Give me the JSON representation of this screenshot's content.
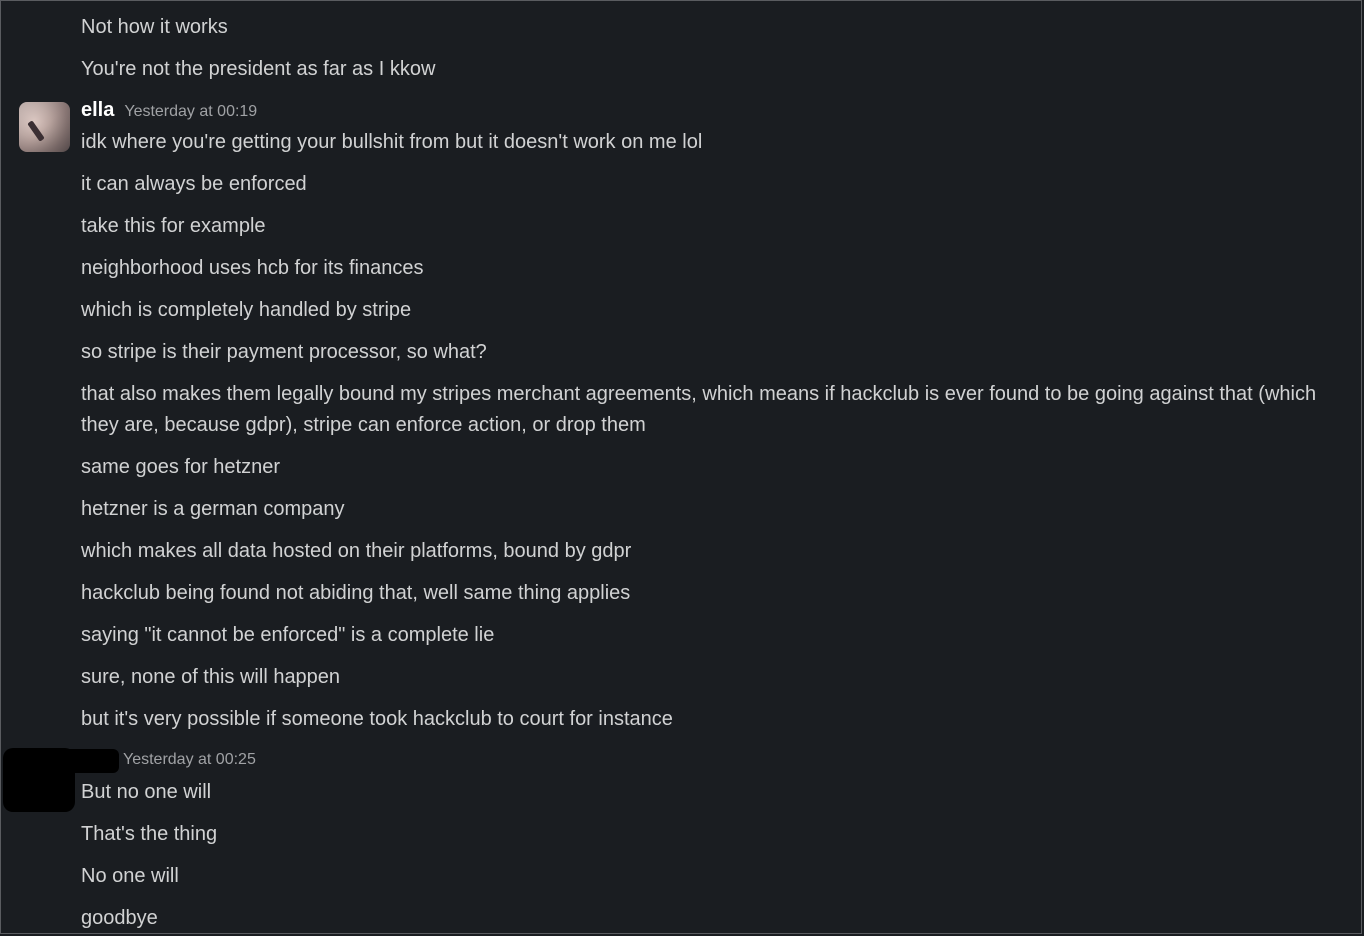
{
  "messages_top": [
    "Not how it works",
    "You're not the president as far as I kkow"
  ],
  "ella": {
    "name": "ella",
    "timestamp": "Yesterday at 00:19",
    "messages": [
      "idk where you're getting your bullshit from but it doesn't work on me lol",
      "it can always be enforced",
      "take this for example",
      "neighborhood uses hcb for its finances",
      "which is completely handled by stripe",
      "so stripe is their payment processor, so what?",
      "that also makes them legally bound my stripes merchant agreements, which means if hackclub is ever found to be going against that (which they are, because gdpr), stripe can enforce action, or drop them",
      "same goes for hetzner",
      "hetzner is a german company",
      "which makes all data hosted on their platforms, bound by gdpr",
      "hackclub being found not abiding that, well same thing applies",
      "saying \"it cannot be enforced\" is a complete lie",
      "sure, none of this will happen",
      "but it's very possible if someone took hackclub to court for instance"
    ]
  },
  "other": {
    "timestamp": "Yesterday at 00:25",
    "messages": [
      "But no one will",
      "That's the thing",
      "No one will",
      "goodbye"
    ]
  }
}
